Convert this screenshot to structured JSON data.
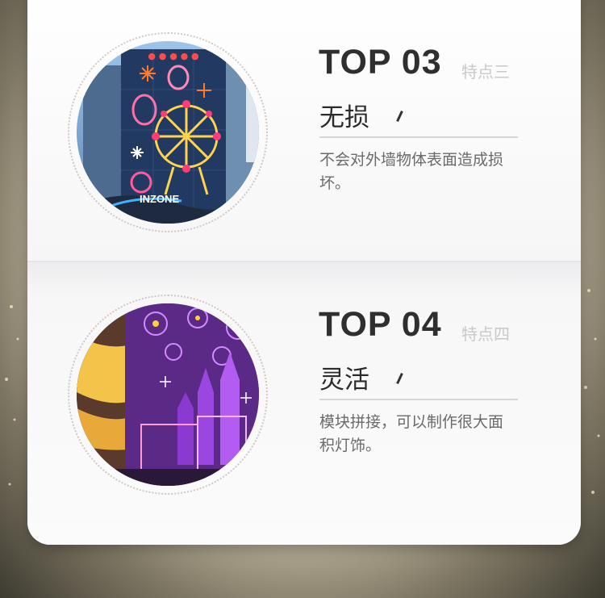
{
  "items": [
    {
      "top_label": "TOP 03",
      "feature_label": "特点三",
      "heading": "无损",
      "description": "不会对外墙物体表面造成损坏。",
      "photo_sign_text": "INZONE"
    },
    {
      "top_label": "TOP 04",
      "feature_label": "特点四",
      "heading": "灵活",
      "description": "模块拼接，可以制作很大面积灯饰。"
    }
  ],
  "colors": {
    "card_bg": "#f7f7f8",
    "title_text": "#2f2f2f",
    "subtitle_text": "#c9c9c9",
    "description_text": "#6a6a6a"
  },
  "icons": {
    "accent_mark": "tick-mark-icon"
  }
}
